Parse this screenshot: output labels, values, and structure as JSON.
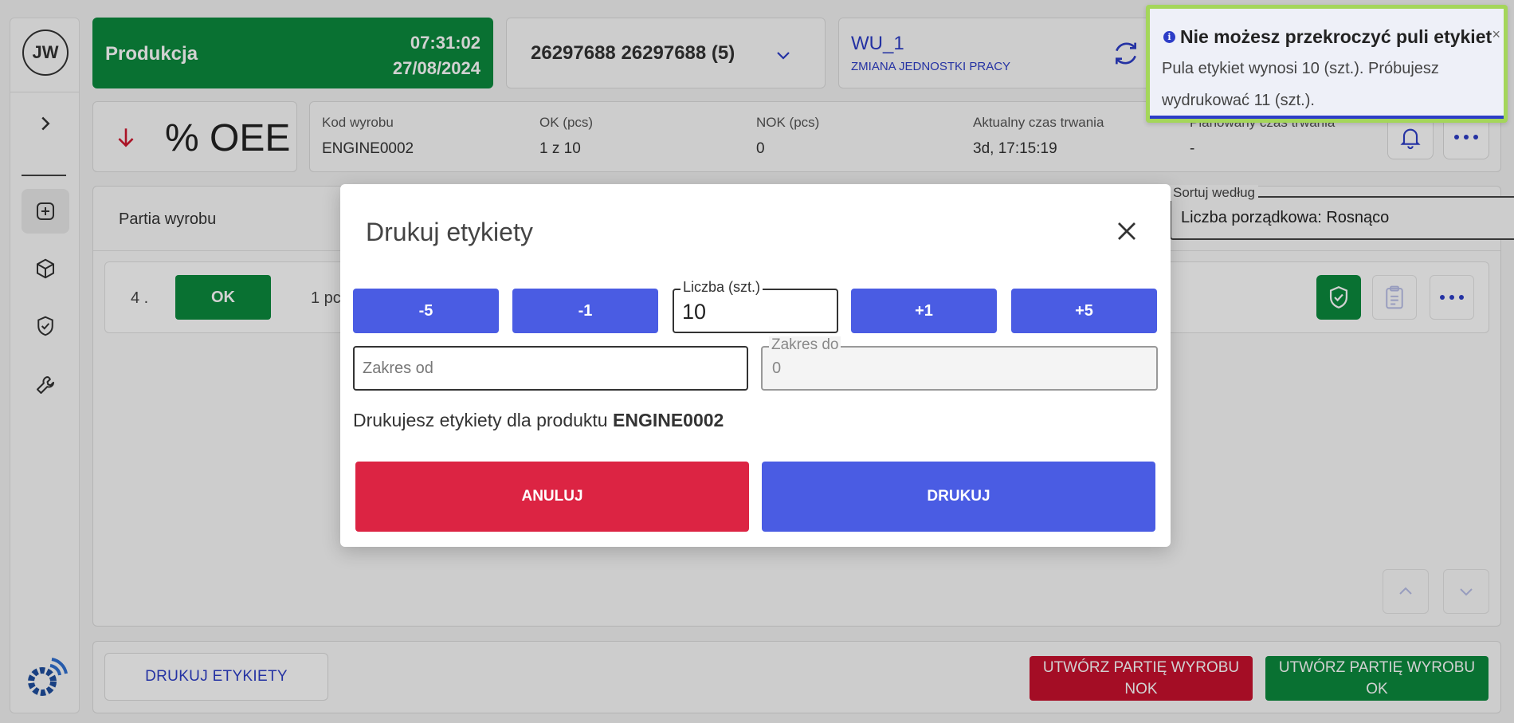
{
  "user": {
    "initials": "JW"
  },
  "production": {
    "title": "Produkcja",
    "time": "07:31:02",
    "date": "27/08/2024"
  },
  "order": {
    "text": "26297688 26297688  (5)"
  },
  "work_unit": {
    "title": "WU_1",
    "subtitle": "ZMIANA JEDNOSTKI PRACY"
  },
  "oee": {
    "label": "% OEE"
  },
  "info": [
    {
      "label": "Kod wyrobu",
      "value": "ENGINE0002"
    },
    {
      "label": "OK (pcs)",
      "value": "1 z 10"
    },
    {
      "label": "NOK (pcs)",
      "value": "0"
    },
    {
      "label": "Aktualny czas trwania",
      "value": "3d, 17:15:19"
    },
    {
      "label": "Planowany czas trwania",
      "value": "-"
    }
  ],
  "panel": {
    "title": "Partia wyrobu",
    "sort_label": "Sortuj według",
    "sort_value": "Liczba porządkowa: Rosnąco"
  },
  "row": {
    "number": "4 .",
    "status": "OK",
    "qty": "1 pc"
  },
  "footer": {
    "print_label": "DRUKUJ ETYKIETY",
    "nok_label_1": "UTWÓRZ PARTIĘ WYROBU",
    "nok_label_2": "NOK",
    "ok_label_1": "UTWÓRZ PARTIĘ WYROBU",
    "ok_label_2": "OK"
  },
  "modal": {
    "title": "Drukuj etykiety",
    "steps": [
      "-5",
      "-1",
      "+1",
      "+5"
    ],
    "quantity_label": "Liczba (szt.)",
    "quantity_value": "10",
    "range_from_placeholder": "Zakres od",
    "range_to_label": "Zakres do",
    "range_to_value": "0",
    "message_prefix": "Drukujesz etykiety dla produktu ",
    "message_product": "ENGINE0002",
    "cancel_label": "ANULUJ",
    "confirm_label": "DRUKUJ"
  },
  "toast": {
    "title": "Nie możesz przekroczyć puli etykiet",
    "body": "Pula etykiet wynosi 10 (szt.). Próbujesz wydrukować 11 (szt.).",
    "close": "×",
    "icon": "i"
  },
  "colors": {
    "green": "#0b8a3e",
    "blue": "#4a5ce3",
    "red": "#dc2443",
    "link_blue": "#2d3dc7",
    "toast_border": "#a4d65a"
  }
}
